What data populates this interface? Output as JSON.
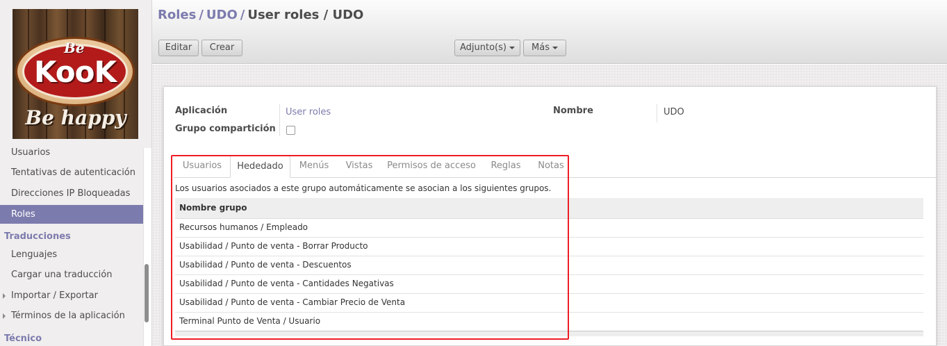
{
  "logo": {
    "top": "Be",
    "main": "KooK",
    "tagline": "Be happy"
  },
  "sidebar": {
    "items": [
      {
        "label": "Usuarios"
      },
      {
        "label": "Tentativas de autenticación"
      },
      {
        "label": "Direcciones IP Bloqueadas"
      },
      {
        "label": "Roles",
        "active": true
      }
    ],
    "section_traducciones": "Traducciones",
    "traducciones_items": [
      {
        "label": "Lenguajes"
      },
      {
        "label": "Cargar una traducción"
      },
      {
        "label": "Importar / Exportar"
      },
      {
        "label": "Términos de la aplicación"
      }
    ],
    "section_tecnico": "Técnico"
  },
  "breadcrumb": {
    "crumb1": "Roles",
    "crumb2": "UDO",
    "sep": "/",
    "current": "User roles / UDO"
  },
  "toolbar": {
    "edit": "Editar",
    "create": "Crear",
    "attachments": "Adjunto(s)",
    "more": "Más"
  },
  "form": {
    "app_label": "Aplicación",
    "app_value": "User roles",
    "share_label": "Grupo compartición",
    "name_label": "Nombre",
    "name_value": "UDO"
  },
  "tabs": [
    "Usuarios",
    "Hededado",
    "Menús",
    "Vistas",
    "Permisos de acceso",
    "Reglas",
    "Notas"
  ],
  "inherited": {
    "description": "Los usuarios asociados a este grupo automáticamente se asocian a los siguientes grupos.",
    "column": "Nombre grupo",
    "rows": [
      "Recursos humanos / Empleado",
      "Usabilidad / Punto de venta - Borrar Producto",
      "Usabilidad / Punto de venta - Descuentos",
      "Usabilidad / Punto de venta - Cantidades Negativas",
      "Usabilidad / Punto de venta - Cambiar Precio de Venta",
      "Terminal Punto de Venta / Usuario"
    ]
  },
  "colors": {
    "accent": "#7c7bad",
    "highlight": "#ee1c24"
  }
}
